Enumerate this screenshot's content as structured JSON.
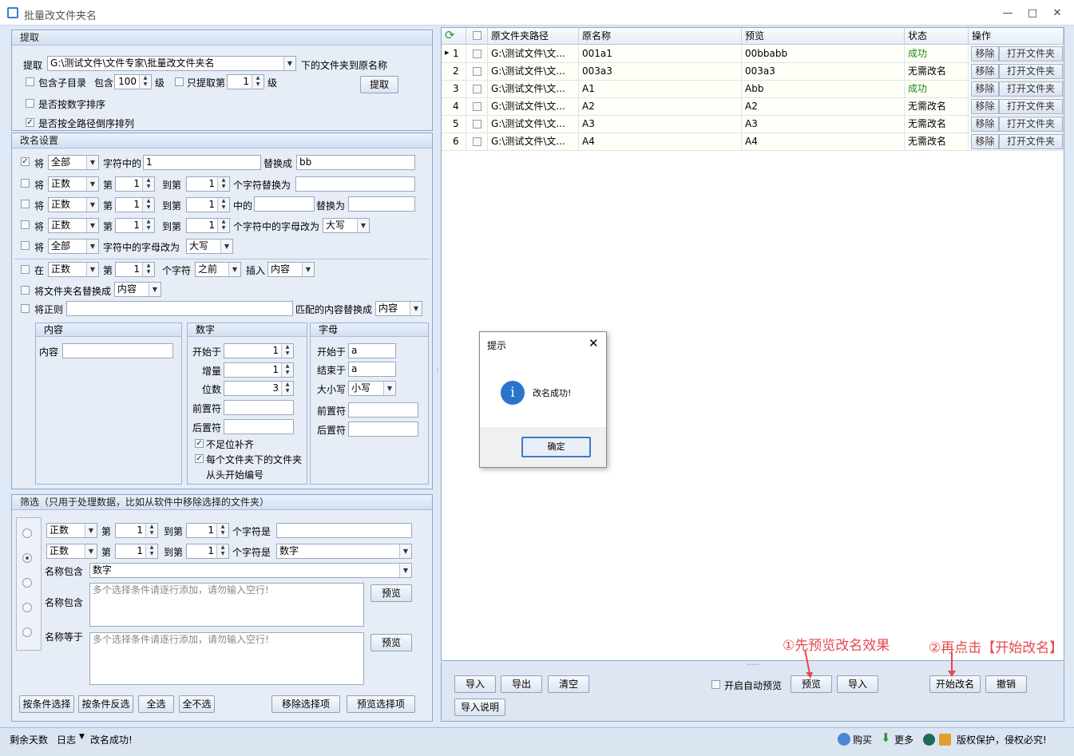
{
  "window": {
    "title": "批量改文件夹名",
    "min": "—",
    "max": "□",
    "close": "✕"
  },
  "extract": {
    "header": "提取",
    "label": "提取",
    "path": "G:\\测试文件\\文件专家\\批量改文件夹名",
    "suffix": "下的文件夹到原名称",
    "include_sub": "包含子目录",
    "include_label": "包含",
    "depth": "100",
    "level": "级",
    "only_label": "只提取第",
    "only_value": "1",
    "level2": "级",
    "num_sort": "是否按数字排序",
    "reverse": "是否按全路径倒序排列",
    "button": "提取"
  },
  "rename": {
    "header": "改名设置",
    "r1": {
      "jiang": "将",
      "scope": "全部",
      "mid": "字符中的",
      "from": "1",
      "to_label": "替换成",
      "to": "bb"
    },
    "r2": {
      "jiang": "将",
      "scope": "正数",
      "di": "第",
      "a": "1",
      "daodi": "到第",
      "b": "1",
      "suffix": "个字符替换为"
    },
    "r3": {
      "jiang": "将",
      "scope": "正数",
      "di": "第",
      "a": "1",
      "daodi": "到第",
      "b": "1",
      "de": "中的",
      "rep": "替换为"
    },
    "r4": {
      "jiang": "将",
      "scope": "正数",
      "di": "第",
      "a": "1",
      "daodi": "到第",
      "b": "1",
      "suffix": "个字符中的字母改为",
      "case": "大写"
    },
    "r5": {
      "jiang": "将",
      "scope": "全部",
      "suffix": "字符中的字母改为",
      "case": "大写"
    },
    "r6": {
      "zai": "在",
      "scope": "正数",
      "di": "第",
      "a": "1",
      "ge": "个字符",
      "pos": "之前",
      "insert": "插入",
      "content": "内容"
    },
    "r7": {
      "label": "将文件夹名替换成",
      "content": "内容"
    },
    "r8": {
      "label": "将正则",
      "suffix": "匹配的内容替换成",
      "content": "内容"
    },
    "content_box": {
      "header": "内容",
      "label": "内容"
    },
    "number_box": {
      "header": "数字",
      "start": "开始于",
      "start_v": "1",
      "inc": "增量",
      "inc_v": "1",
      "digits": "位数",
      "digits_v": "3",
      "prefix": "前置符",
      "suffix": "后置符",
      "pad": "不足位补齐",
      "restart": "每个文件夹下的文件夹",
      "restart2": "从头开始编号"
    },
    "letter_box": {
      "header": "字母",
      "start": "开始于",
      "start_v": "a",
      "end": "结束于",
      "end_v": "a",
      "case": "大小写",
      "case_v": "小写",
      "prefix": "前置符",
      "suffix": "后置符"
    }
  },
  "filter": {
    "header": "筛选（只用于处理数据，比如从软件中移除选择的文件夹）",
    "f1": {
      "scope": "正数",
      "di": "第",
      "a": "1",
      "daodi": "到第",
      "b": "1",
      "suffix": "个字符是"
    },
    "f2": {
      "scope": "正数",
      "di": "第",
      "a": "1",
      "daodi": "到第",
      "b": "1",
      "suffix": "个字符是",
      "type": "数字"
    },
    "f3": {
      "label": "名称包含",
      "value": "数字"
    },
    "f4": {
      "label": "名称包含",
      "placeholder": "多个选择条件请逐行添加，请勿输入空行!",
      "btn": "预览"
    },
    "f5": {
      "label": "名称等于",
      "placeholder": "多个选择条件请逐行添加，请勿输入空行!",
      "btn": "预览"
    },
    "buttons": [
      "按条件选择",
      "按条件反选",
      "全选",
      "全不选",
      "移除选择项",
      "预览选择项"
    ]
  },
  "grid": {
    "headers": [
      "原文件夹路径",
      "原名称",
      "预览",
      "状态",
      "操作"
    ],
    "rows": [
      {
        "no": "1",
        "path": "G:\\测试文件\\文...",
        "name": "001a1",
        "preview": "00bbabb",
        "status": "成功",
        "ok": true
      },
      {
        "no": "2",
        "path": "G:\\测试文件\\文...",
        "name": "003a3",
        "preview": "003a3",
        "status": "无需改名",
        "ok": false
      },
      {
        "no": "3",
        "path": "G:\\测试文件\\文...",
        "name": "A1",
        "preview": "Abb",
        "status": "成功",
        "ok": true
      },
      {
        "no": "4",
        "path": "G:\\测试文件\\文...",
        "name": "A2",
        "preview": "A2",
        "status": "无需改名",
        "ok": false
      },
      {
        "no": "5",
        "path": "G:\\测试文件\\文...",
        "name": "A3",
        "preview": "A3",
        "status": "无需改名",
        "ok": false
      },
      {
        "no": "6",
        "path": "G:\\测试文件\\文...",
        "name": "A4",
        "preview": "A4",
        "status": "无需改名",
        "ok": false
      }
    ],
    "remove": "移除",
    "open": "打开文件夹",
    "success_color": "#1a8a1a"
  },
  "bottom": {
    "import": "导入",
    "export": "导出",
    "clear": "清空",
    "auto_preview": "开启自动预览",
    "preview": "预览",
    "import2": "导入",
    "start": "开始改名",
    "undo": "撤销",
    "help": "导入说明",
    "grip": "....."
  },
  "annotations": {
    "a1": "①先预览改名效果",
    "a2": "②再点击【开始改名】"
  },
  "dialog": {
    "title": "提示",
    "close": "✕",
    "message": "改名成功!",
    "ok": "确定",
    "icon": "i"
  },
  "status": {
    "days": "剩余天数",
    "log": "日志",
    "msg": "改名成功!",
    "buy": "购买",
    "more": "更多",
    "copyright": "版权保护，侵权必究!"
  }
}
